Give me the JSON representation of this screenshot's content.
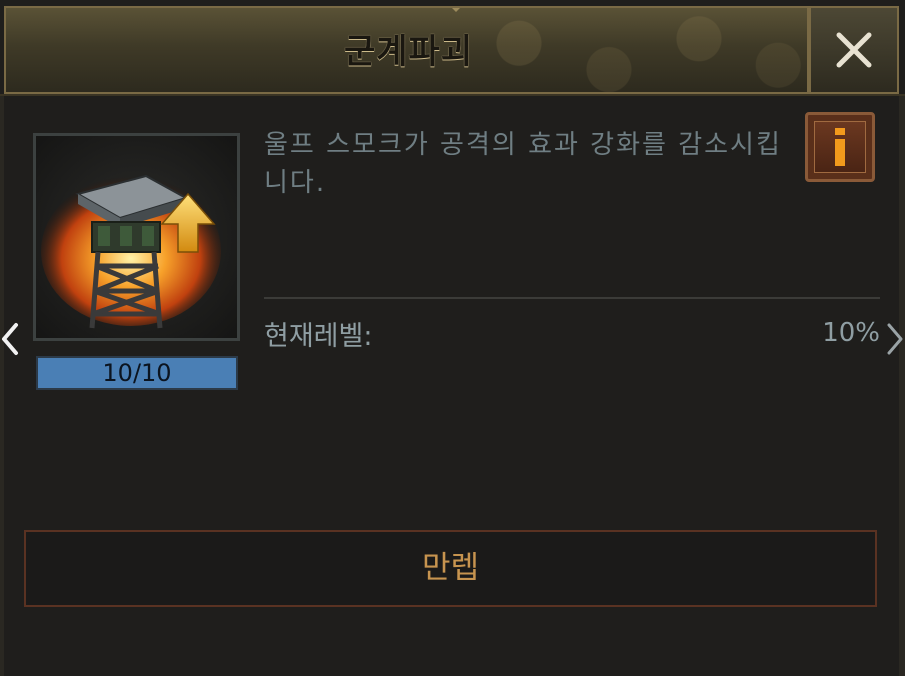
{
  "dialog": {
    "title": "군계파괴",
    "close_icon": "close-x-icon"
  },
  "skill": {
    "icon": "watchtower-upgrade-icon",
    "level_text": "10/10",
    "description": "울프 스모크가 공격의 효과 강화를 감소시킵니다.",
    "current_level_label": "현재레벨:",
    "current_level_value": "10%"
  },
  "info_button": {
    "icon": "info-icon",
    "label": "i"
  },
  "navigation": {
    "prev_icon": "chevron-left-icon",
    "next_icon": "chevron-right-icon"
  },
  "actions": {
    "max_level_label": "만렙"
  },
  "colors": {
    "title_bar": "#5a5236",
    "level_badge": "#4a7fb5",
    "button_text": "#c7944f",
    "info_button": "#5a2f1a"
  }
}
